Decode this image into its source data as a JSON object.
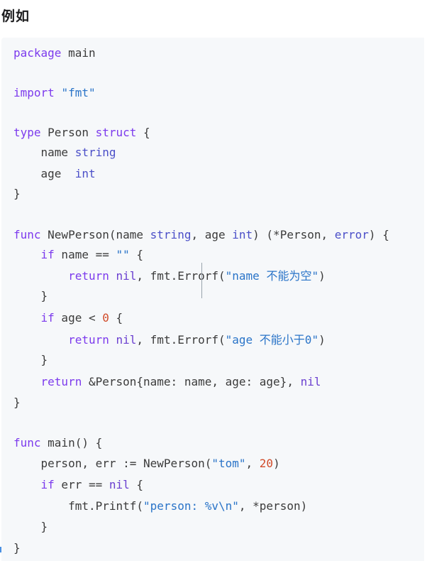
{
  "heading": "例如",
  "code": {
    "l1": [
      "package",
      " main"
    ],
    "l2": [
      "import",
      " ",
      "\"fmt\""
    ],
    "l3": [
      "type",
      " Person ",
      "struct",
      " {"
    ],
    "l4": [
      "    name ",
      "string"
    ],
    "l5": [
      "    age  ",
      "int"
    ],
    "l6": [
      "}"
    ],
    "l7": [
      "func",
      " NewPerson(name ",
      "string",
      ", age ",
      "int",
      ") (*Person, ",
      "error",
      ") {"
    ],
    "l8": [
      "    ",
      "if",
      " name == ",
      "\"\"",
      " {"
    ],
    "l9": [
      "        ",
      "return",
      " ",
      "nil",
      ", fmt.Errorf(",
      "\"name 不能为空\"",
      ")"
    ],
    "l10": [
      "    }"
    ],
    "l11": [
      "    ",
      "if",
      " age < ",
      "0",
      " {"
    ],
    "l12": [
      "        ",
      "return",
      " ",
      "nil",
      ", fmt.Errorf(",
      "\"age 不能小于0\"",
      ")"
    ],
    "l13": [
      "    }"
    ],
    "l14": [
      "    ",
      "return",
      " &Person{name: name, age: age}, ",
      "nil"
    ],
    "l15": [
      "}"
    ],
    "l16": [
      "func",
      " main() {"
    ],
    "l17": [
      "    person, err := NewPerson(",
      "\"tom\"",
      ", ",
      "20",
      ")"
    ],
    "l18": [
      "    ",
      "if",
      " err == ",
      "nil",
      " {"
    ],
    "l19": [
      "        fmt.Printf(",
      "\"person: %v\\n\"",
      ", *person)"
    ],
    "l20": [
      "    }"
    ],
    "l21": [
      "}"
    ]
  }
}
